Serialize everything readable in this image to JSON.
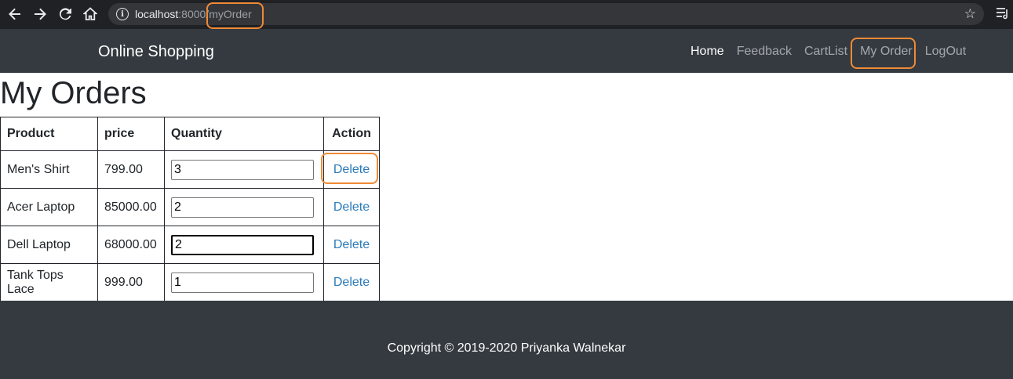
{
  "browser": {
    "url_host": "localhost",
    "url_rest": ":8000/myOrder"
  },
  "navbar": {
    "brand": "Online Shopping",
    "links": [
      "Home",
      "Feedback",
      "CartList",
      "My Order",
      "LogOut"
    ]
  },
  "main": {
    "title": "My Orders",
    "columns": [
      "Product",
      "price",
      "Quantity",
      "Action"
    ],
    "rows": [
      {
        "product": "Men's Shirt",
        "price": "799.00",
        "quantity": "3",
        "action": "Delete"
      },
      {
        "product": "Acer Laptop",
        "price": "85000.00",
        "quantity": "2",
        "action": "Delete"
      },
      {
        "product": "Dell Laptop",
        "price": "68000.00",
        "quantity": "2",
        "action": "Delete"
      },
      {
        "product": "Tank Tops Lace",
        "price": "999.00",
        "quantity": "1",
        "action": "Delete"
      }
    ]
  },
  "footer": {
    "copyright": "Copyright © 2019-2020 Priyanka Walnekar"
  },
  "colors": {
    "navbar_bg": "#343a40",
    "link": "#2a7ab9",
    "highlight": "#f08a36"
  }
}
